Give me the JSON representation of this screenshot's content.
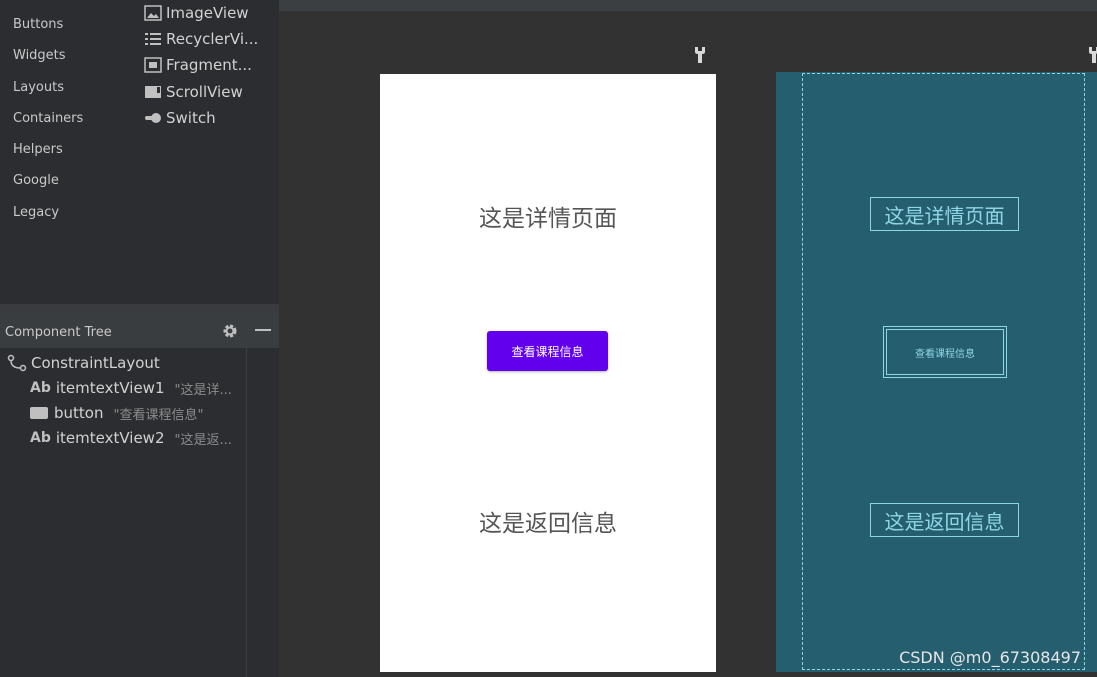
{
  "palette": {
    "categories": [
      "Buttons",
      "Widgets",
      "Layouts",
      "Containers",
      "Helpers",
      "Google",
      "Legacy"
    ],
    "items": [
      {
        "label": "ImageView",
        "icon": "image-icon"
      },
      {
        "label": "RecyclerVi...",
        "icon": "list-icon"
      },
      {
        "label": "Fragment...",
        "icon": "fragment-icon"
      },
      {
        "label": "ScrollView",
        "icon": "scrollview-icon"
      },
      {
        "label": "Switch",
        "icon": "switch-icon"
      }
    ]
  },
  "component_tree": {
    "title": "Component Tree",
    "nodes": [
      {
        "icon": "constraint-layout-icon",
        "label": "ConstraintLayout",
        "hint": ""
      },
      {
        "icon": "textview-icon",
        "icon_text": "Ab",
        "label": "itemtextView1",
        "hint": "\"这是详..."
      },
      {
        "icon": "button-icon",
        "label": "button",
        "hint": "\"查看课程信息\""
      },
      {
        "icon": "textview-icon",
        "icon_text": "Ab",
        "label": "itemtextView2",
        "hint": "\"这是返..."
      }
    ]
  },
  "design": {
    "text1": "这是详情页面",
    "button_label": "查看课程信息",
    "text2": "这是返回信息",
    "colors": {
      "button": "#6200ee",
      "blueprint": "#255e6f",
      "blueprint_line": "#8fd6e5"
    }
  },
  "blueprint": {
    "text1": "这是详情页面",
    "button_label": "查看课程信息",
    "text2": "这是返回信息"
  },
  "watermark": "CSDN @m0_67308497"
}
